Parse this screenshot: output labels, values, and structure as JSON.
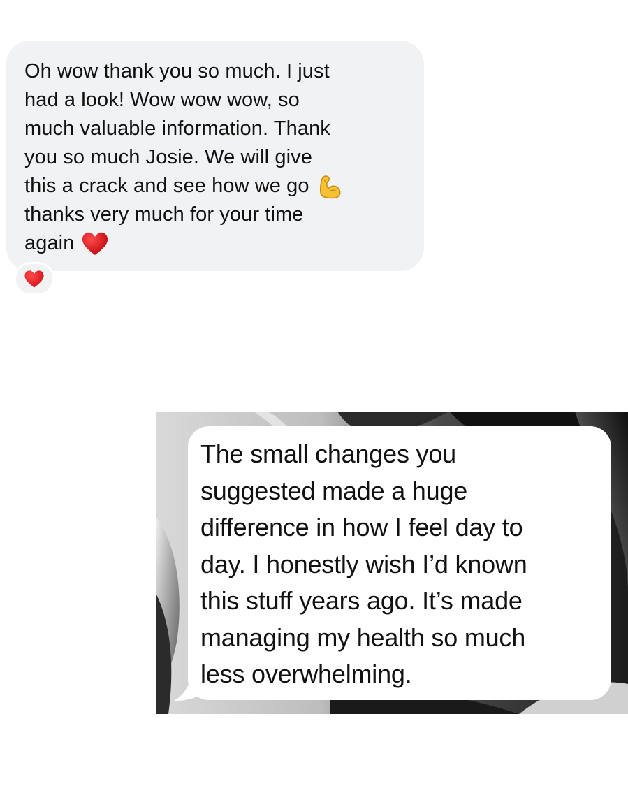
{
  "conversation": {
    "message_1": {
      "lines": [
        "Oh wow thank you so much. I just",
        "had a look! Wow wow wow, so",
        "much valuable information. Thank",
        "you so much Josie. We will give",
        "this a crack and see how we go",
        "thanks very much for your time",
        "again"
      ],
      "inline_emoji_line5": "flexed-biceps",
      "inline_emoji_line7": "red-heart",
      "reaction": "red-heart",
      "bubble_color": "#f1f2f4"
    },
    "message_2": {
      "lines": [
        "The small changes you",
        "suggested made a huge",
        "difference in how I feel day to",
        "day. I honestly wish I’d known",
        "this stuff years ago. It’s made",
        "managing my health so much",
        "less overwhelming."
      ],
      "bubble_color": "#ffffff",
      "background": "black-and-white-leaf-photo"
    }
  }
}
